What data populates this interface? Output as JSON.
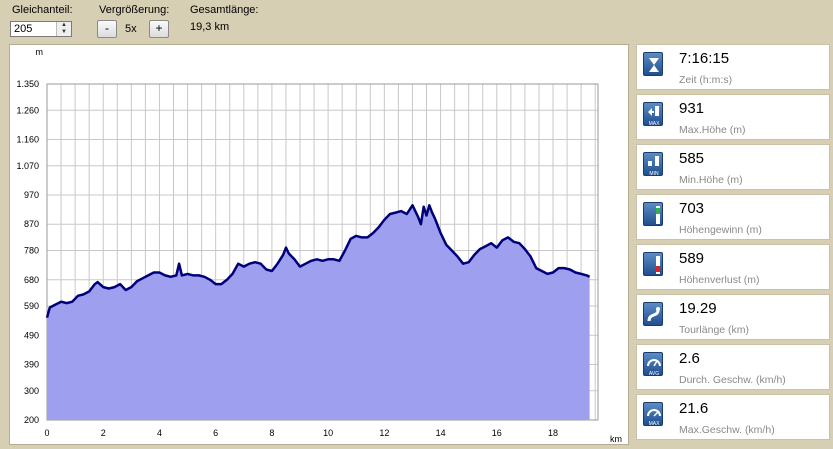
{
  "toolbar": {
    "offset_label": "Gleichanteil:",
    "offset_value": "205",
    "zoom_label": "Vergrößerung:",
    "zoom_minus": "-",
    "zoom_value": "5x",
    "zoom_plus": "+",
    "total_label": "Gesamtlänge:",
    "total_value": "19,3 km"
  },
  "chart_data": {
    "type": "area",
    "xlabel": "km",
    "ylabel": "m",
    "xlim": [
      0,
      19.6
    ],
    "ylim": [
      200,
      1350
    ],
    "x_ticks": [
      "0",
      "2",
      "4",
      "6",
      "8",
      "10",
      "12",
      "14",
      "16",
      "18"
    ],
    "y_ticks": [
      "200",
      "300",
      "390",
      "490",
      "590",
      "680",
      "780",
      "870",
      "970",
      "1.070",
      "1.160",
      "1.260",
      "1.350"
    ],
    "grid": true,
    "fill_color": "#9f9ff0",
    "line_color": "#00007a",
    "series": [
      {
        "x": [
          0,
          0.1,
          0.3,
          0.5,
          0.7,
          0.9,
          1.1,
          1.3,
          1.5,
          1.7,
          1.8,
          2.0,
          2.2,
          2.4,
          2.6,
          2.8,
          3.0,
          3.2,
          3.4,
          3.6,
          3.8,
          4.0,
          4.2,
          4.4,
          4.6,
          4.7,
          4.8,
          5.0,
          5.2,
          5.4,
          5.6,
          5.8,
          6.0,
          6.2,
          6.4,
          6.6,
          6.8,
          7.0,
          7.2,
          7.4,
          7.6,
          7.8,
          8.0,
          8.2,
          8.4,
          8.5,
          8.6,
          8.8,
          9.0,
          9.2,
          9.4,
          9.6,
          9.8,
          10.0,
          10.2,
          10.4,
          10.6,
          10.8,
          11.0,
          11.2,
          11.4,
          11.6,
          11.8,
          12.0,
          12.2,
          12.4,
          12.6,
          12.8,
          13.0,
          13.2,
          13.3,
          13.4,
          13.5,
          13.6,
          13.7,
          13.8,
          14.0,
          14.2,
          14.4,
          14.6,
          14.8,
          15.0,
          15.2,
          15.4,
          15.6,
          15.8,
          16.0,
          16.2,
          16.4,
          16.6,
          16.8,
          17.0,
          17.2,
          17.4,
          17.6,
          17.8,
          18.0,
          18.2,
          18.4,
          18.6,
          18.8,
          19.0,
          19.2,
          19.3
        ],
        "y": [
          550,
          585,
          595,
          605,
          600,
          605,
          625,
          630,
          640,
          665,
          672,
          655,
          650,
          655,
          665,
          645,
          655,
          675,
          685,
          695,
          705,
          705,
          695,
          690,
          695,
          735,
          695,
          700,
          695,
          695,
          690,
          680,
          665,
          665,
          680,
          700,
          735,
          725,
          735,
          740,
          735,
          715,
          710,
          735,
          765,
          790,
          770,
          750,
          725,
          735,
          745,
          750,
          745,
          750,
          750,
          745,
          780,
          820,
          830,
          825,
          825,
          840,
          860,
          885,
          905,
          910,
          915,
          905,
          935,
          895,
          870,
          930,
          900,
          935,
          910,
          890,
          840,
          800,
          780,
          760,
          735,
          740,
          765,
          785,
          795,
          805,
          790,
          815,
          825,
          810,
          805,
          785,
          760,
          720,
          710,
          700,
          705,
          720,
          720,
          715,
          705,
          700,
          695,
          690
        ]
      }
    ]
  },
  "stats": [
    {
      "value": "7:16:15",
      "label": "Zeit (h:m:s)",
      "icon": "hourglass-icon"
    },
    {
      "value": "931",
      "label": "Max.Höhe (m)",
      "icon": "max-altitude-icon",
      "badge": "MAX"
    },
    {
      "value": "585",
      "label": "Min.Höhe (m)",
      "icon": "min-altitude-icon",
      "badge": "MIN"
    },
    {
      "value": "703",
      "label": "Höhengewinn (m)",
      "icon": "elevation-gain-icon"
    },
    {
      "value": "589",
      "label": "Höhenverlust (m)",
      "icon": "elevation-loss-icon"
    },
    {
      "value": "19.29",
      "label": "Tourlänge (km)",
      "icon": "route-distance-icon"
    },
    {
      "value": "2.6",
      "label": "Durch. Geschw. (km/h)",
      "icon": "avg-speed-icon",
      "badge": "AVG"
    },
    {
      "value": "21.6",
      "label": "Max.Geschw. (km/h)",
      "icon": "max-speed-icon",
      "badge": "MAX"
    }
  ]
}
